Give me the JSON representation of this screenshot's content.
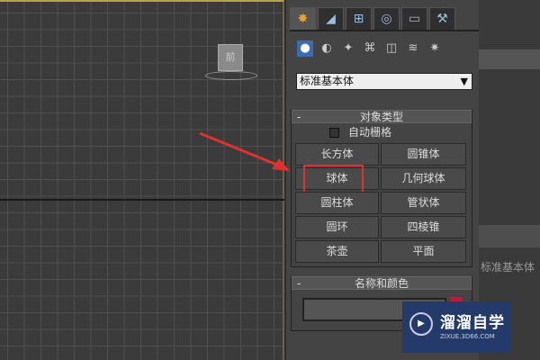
{
  "viewport": {
    "viewcube_label": "前"
  },
  "panel": {
    "tabs": [
      {
        "name": "create",
        "icon": "✸"
      },
      {
        "name": "modify",
        "icon": "◢"
      },
      {
        "name": "hierarchy",
        "icon": "⊞"
      },
      {
        "name": "motion",
        "icon": "◎"
      },
      {
        "name": "display",
        "icon": "▭"
      },
      {
        "name": "utilities",
        "icon": "⚒"
      }
    ],
    "category_icons": [
      "●",
      "◐",
      "✦",
      "⌘",
      "◫",
      "≋",
      "✷"
    ],
    "dropdown": "标准基本体",
    "object_type": {
      "title": "对象类型",
      "collapse": "-",
      "autogrid": "自动栅格",
      "buttons": [
        "长方体",
        "圆锥体",
        "球体",
        "几何球体",
        "圆柱体",
        "管状体",
        "圆环",
        "四棱锥",
        "茶壶",
        "平面"
      ],
      "highlighted": "球体"
    },
    "name_color": {
      "title": "名称和颜色",
      "collapse": "-",
      "name_value": "",
      "color": "#b02040"
    }
  },
  "background_text": "标准基本体",
  "watermark": {
    "title": "溜溜自学",
    "url": "ZIXUE.3D66.COM"
  }
}
